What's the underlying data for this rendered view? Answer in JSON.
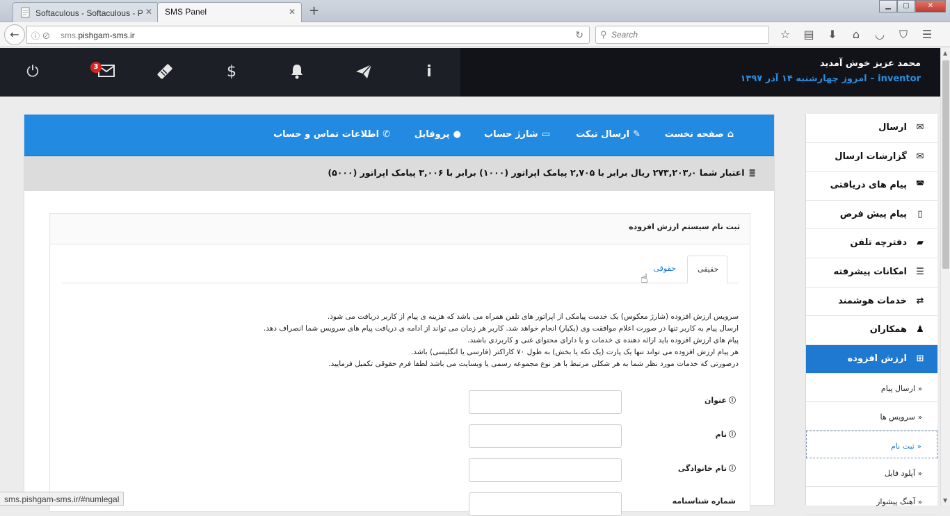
{
  "browser": {
    "tabs": [
      {
        "label": "Softaculous - Softaculous - P"
      },
      {
        "label": "SMS Panel"
      }
    ],
    "url_prefix": "sms.",
    "url_host": "pishgam-sms.ir",
    "search_placeholder": "Search",
    "status_url": "sms.pishgam-sms.ir/#numlegal"
  },
  "header": {
    "welcome": "محمد عزیز خوش آمدید",
    "username": "inventor",
    "date_sep": " – ",
    "date_text": "امروز چهارشنبه ۱۴ آذر ۱۳۹۷",
    "message_count": "3",
    "icons": [
      "power-icon",
      "envelope-icon",
      "ticket-icon",
      "dollar-icon",
      "bell-icon",
      "paper-plane-icon",
      "info-icon"
    ]
  },
  "topnav": {
    "home": "صفحه نخست",
    "ticket": "ارسال تیکت",
    "charge": "شارژ حساب",
    "profile": "پروفایل",
    "contact": "اطلاعات تماس و حساب"
  },
  "credit_text": "اعتبار شما ۲۷۳,۲۰۳٫۰ ریال برابر با ۲,۷۰۵ پیامک اپراتور (۱۰۰۰) برابر با ۳,۰۰۶ پیامک اپراتور (۵۰۰۰)",
  "form": {
    "title": "ثبت نام سیستم ارزش افزوده",
    "tab_real": "حقیقی",
    "tab_legal": "حقوقی",
    "desc_lines": [
      "سرویس ارزش افزوده (شارژ معکوس) یک خدمت پیامکی از اپراتور های تلفن همراه می باشد که هزینه ی پیام از کاربر دریافت می شود.",
      "ارسال پیام به کاربر تنها در صورت اعلام موافقت وی (یکبار) انجام خواهد شد. کاربر هر زمان می تواند از ادامه ی دریافت پیام های سرویس شما انصراف دهد.",
      "پیام های ارزش افزوده باید ارائه دهنده ی خدمات و یا دارای محتوای غنی و کاربردی باشند.",
      "هر پیام ارزش افزوده می تواند تنها یک پارت (یک تکه یا بخش) به طول ۷۰ کاراکتر (فارسی یا انگلیسی) باشد.",
      "درصورتی که خدمات مورد نظر شما به هر شکلی مرتبط با هر نوع مجموعه رسمی یا وبسایت می باشد لطفا فرم حقوقی تکمیل فرمایید."
    ],
    "fields": [
      {
        "label": "عنوان",
        "value": ""
      },
      {
        "label": "نام",
        "value": ""
      },
      {
        "label": "نام خانوادگی",
        "value": ""
      },
      {
        "label": "شماره شناسنامه",
        "value": ""
      }
    ]
  },
  "sidebar": {
    "items": [
      {
        "label": "ارسال",
        "icon": "envelope-icon"
      },
      {
        "label": "گزارشات ارسال",
        "icon": "envelope-open-icon"
      },
      {
        "label": "پیام های دریافتی",
        "icon": "inbox-icon"
      },
      {
        "label": "پیام پیش فرض",
        "icon": "file-icon"
      },
      {
        "label": "دفترچه تلفن",
        "icon": "book-icon"
      },
      {
        "label": "امکانات پیشرفته",
        "icon": "server-icon"
      },
      {
        "label": "خدمات هوشمند",
        "icon": "retweet-icon"
      },
      {
        "label": "همکاران",
        "icon": "user-icon"
      },
      {
        "label": "ارزش افزوده",
        "icon": "plus-square-icon"
      }
    ],
    "sub_items": [
      {
        "label": "ارسال پیام"
      },
      {
        "label": "سرویس ها"
      },
      {
        "label": "ثبت نام"
      },
      {
        "label": "آپلود فایل"
      },
      {
        "label": "آهنگ پیشواز"
      }
    ]
  }
}
